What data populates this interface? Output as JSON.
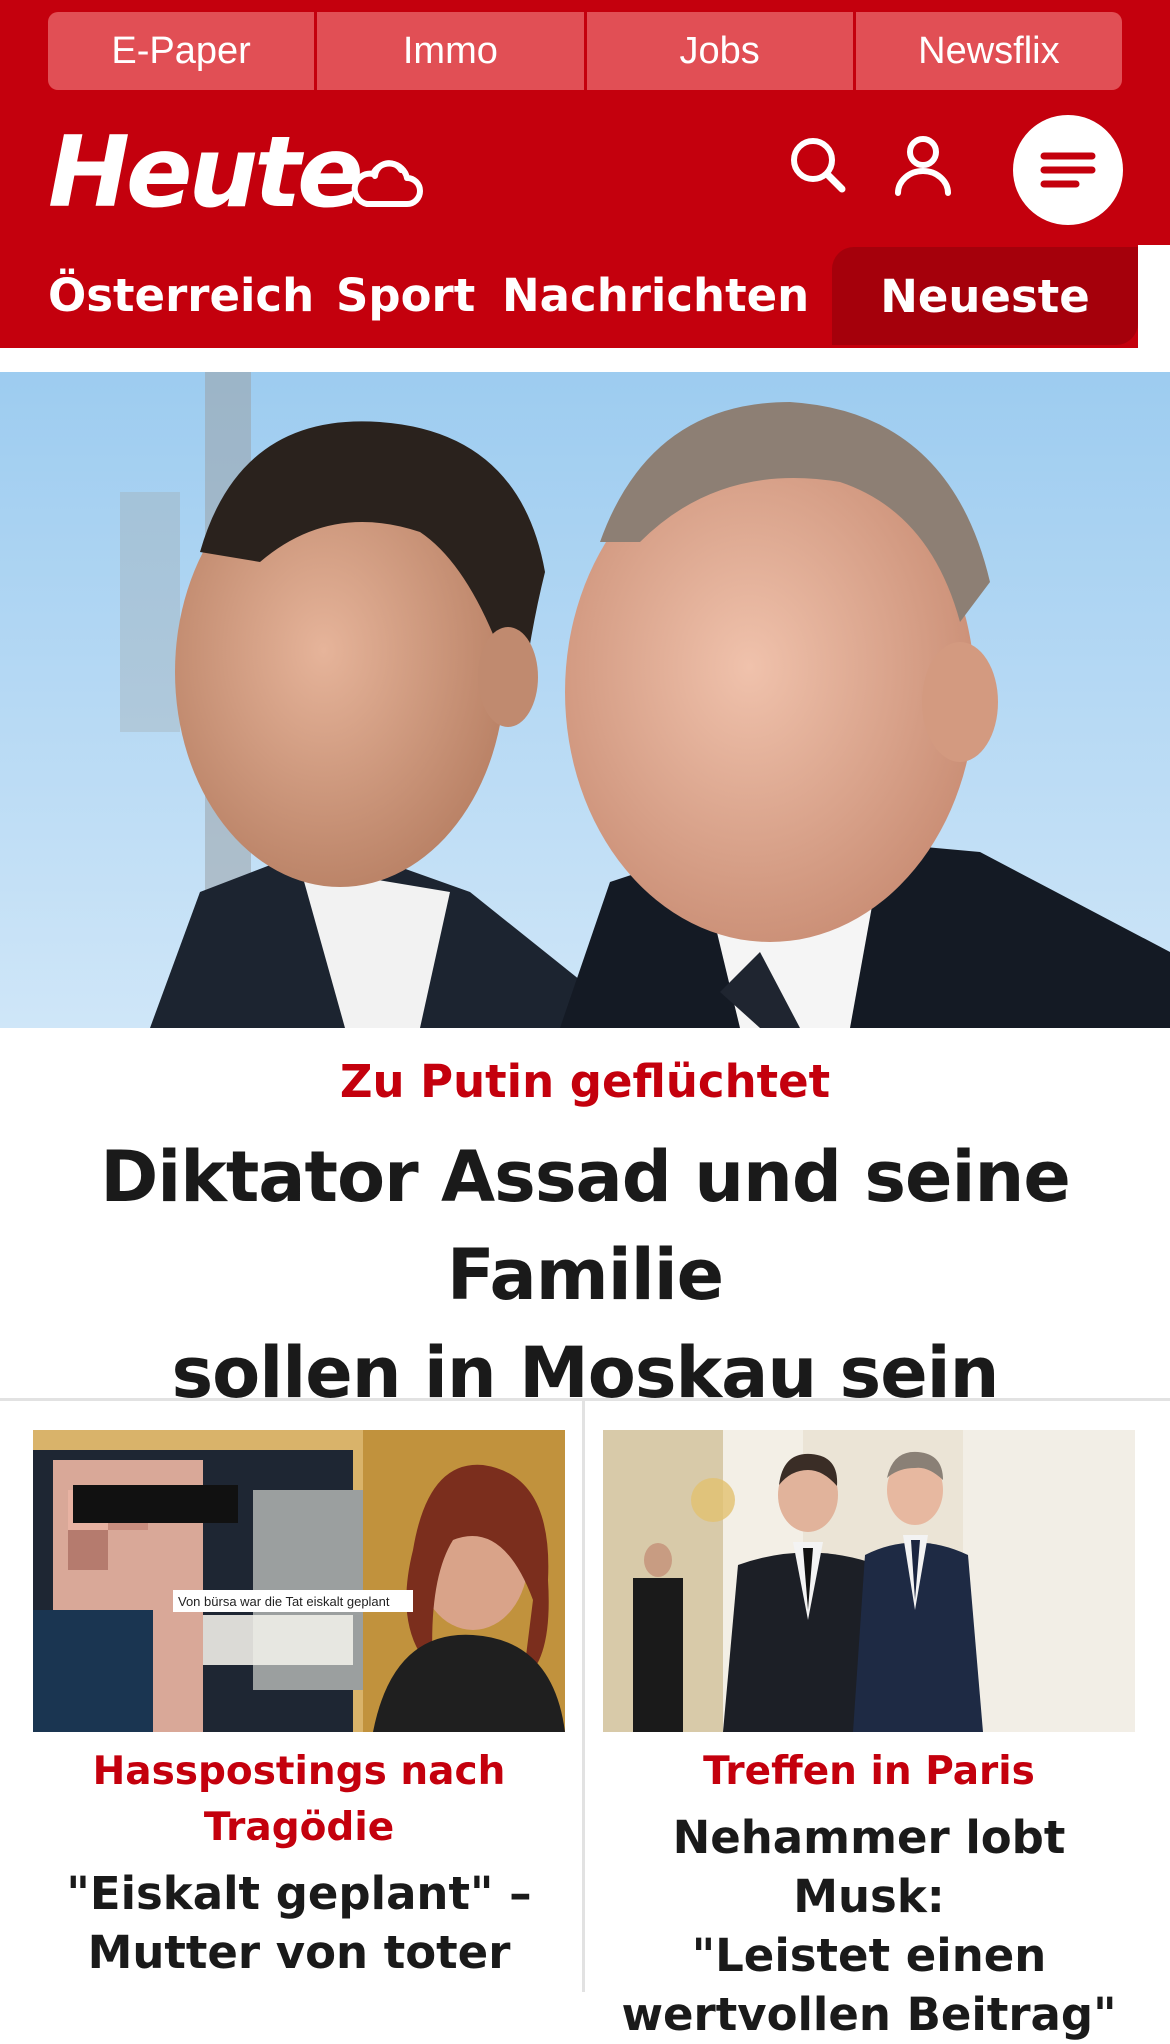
{
  "colors": {
    "brand_red": "#c4000d",
    "tab_red": "#e14f55",
    "active_nav": "#a5000b"
  },
  "top_tabs": [
    {
      "label": "E-Paper"
    },
    {
      "label": "Immo"
    },
    {
      "label": "Jobs"
    },
    {
      "label": "Newsflix"
    }
  ],
  "header": {
    "logo": "Heute",
    "weather_icon": "cloud-icon",
    "search_icon": "search-icon",
    "user_icon": "user-icon",
    "menu_icon": "menu-icon"
  },
  "nav": {
    "items": [
      {
        "label": "Österreich"
      },
      {
        "label": "Sport"
      },
      {
        "label": "Nachrichten"
      }
    ],
    "active": "Neueste"
  },
  "hero": {
    "kicker": "Zu Putin geflüchtet",
    "title_line1": "Diktator Assad und seine Familie",
    "title_line2": "sollen in Moskau sein"
  },
  "cards": [
    {
      "image_caption": "Von bürsa war die Tat eiskalt geplant",
      "kicker_line1": "Hasspostings nach",
      "kicker_line2": "Tragödie",
      "title_line1": "\"Eiskalt geplant\" –",
      "title_line2": "Mutter von toter"
    },
    {
      "kicker_line1": "Treffen in Paris",
      "title_line1": "Nehammer lobt Musk:",
      "title_line2": "\"Leistet einen",
      "title_line3": "wertvollen Beitrag\""
    }
  ]
}
